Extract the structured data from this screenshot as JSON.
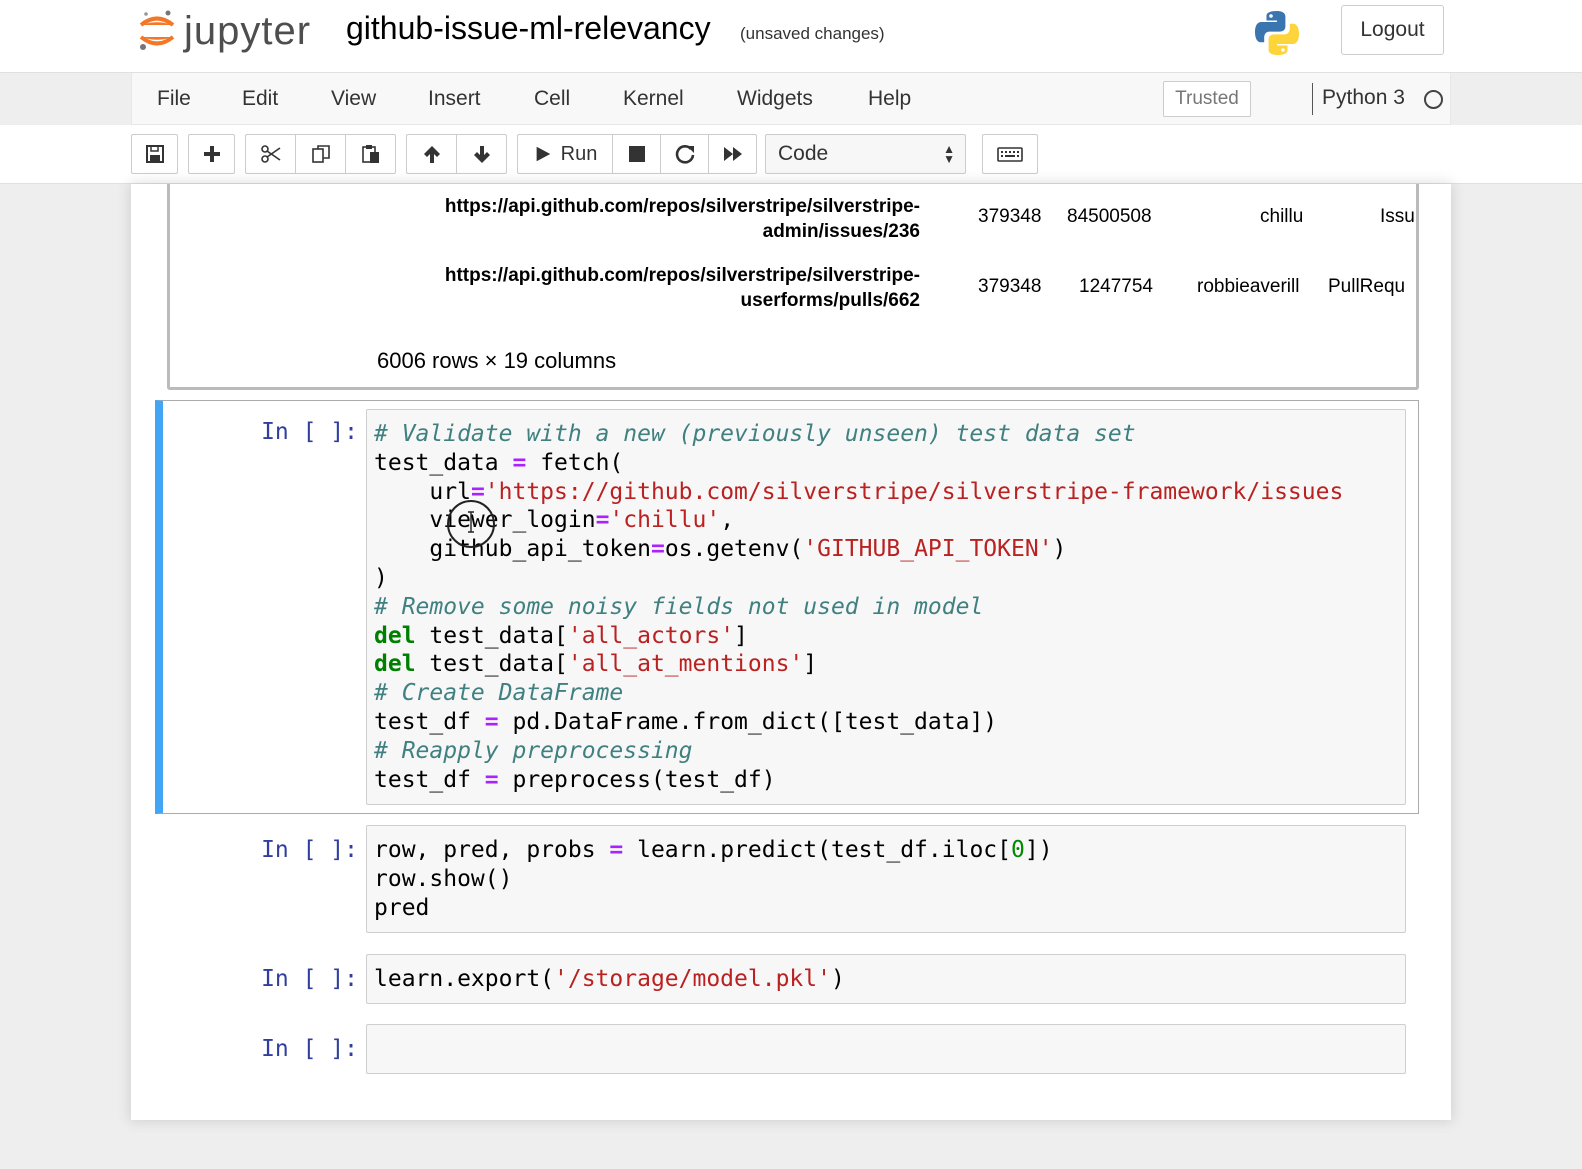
{
  "header": {
    "logo_text": "jupyter",
    "notebook_title": "github-issue-ml-relevancy",
    "save_status": "(unsaved changes)",
    "logout_label": "Logout"
  },
  "menubar": {
    "items": [
      "File",
      "Edit",
      "View",
      "Insert",
      "Cell",
      "Kernel",
      "Widgets",
      "Help"
    ],
    "trusted_label": "Trusted",
    "kernel_name": "Python 3"
  },
  "toolbar": {
    "run_label": "Run",
    "cell_type": "Code",
    "buttons": [
      "save-icon",
      "plus-icon",
      "scissors-icon",
      "copy-icon",
      "paste-icon",
      "arrow-up-icon",
      "arrow-down-icon",
      "play-icon",
      "stop-icon",
      "restart-icon",
      "fast-forward-icon",
      "keyboard-icon"
    ]
  },
  "dataframe": {
    "rows": [
      {
        "url_line1": "https://api.github.com/repos/silverstripe/silverstripe-",
        "url_line2": "admin/issues/236",
        "col1": "379348",
        "col2": "84500508",
        "col3": "chillu",
        "col4": "Issu"
      },
      {
        "url_line1": "https://api.github.com/repos/silverstripe/silverstripe-",
        "url_line2": "userforms/pulls/662",
        "col1": "379348",
        "col2": "1247754",
        "col3": "robbieaverill",
        "col4": "PullRequ"
      }
    ],
    "summary": "6006 rows × 19 columns"
  },
  "cells": [
    {
      "prompt": "In [ ]:",
      "lines": [
        [
          {
            "t": "# Validate with a new (previously unseen) test data set",
            "c": "comment"
          }
        ],
        [
          {
            "t": "test_data "
          },
          {
            "t": "=",
            "c": "op"
          },
          {
            "t": " fetch("
          }
        ],
        [
          {
            "t": "    url"
          },
          {
            "t": "=",
            "c": "op"
          },
          {
            "t": "'https://github.com/silverstripe/silverstripe-framework/issues",
            "c": "string"
          }
        ],
        [
          {
            "t": "    viewer_login"
          },
          {
            "t": "=",
            "c": "op"
          },
          {
            "t": "'chillu'",
            "c": "string"
          },
          {
            "t": ","
          }
        ],
        [
          {
            "t": "    github_api_token"
          },
          {
            "t": "=",
            "c": "op"
          },
          {
            "t": "os.getenv("
          },
          {
            "t": "'GITHUB_API_TOKEN'",
            "c": "string"
          },
          {
            "t": ")"
          }
        ],
        [
          {
            "t": ")"
          }
        ],
        [
          {
            "t": "# Remove some noisy fields not used in model",
            "c": "comment"
          }
        ],
        [
          {
            "t": "del",
            "c": "keyword"
          },
          {
            "t": " test_data["
          },
          {
            "t": "'all_actors'",
            "c": "string"
          },
          {
            "t": "]"
          }
        ],
        [
          {
            "t": "del",
            "c": "keyword"
          },
          {
            "t": " test_data["
          },
          {
            "t": "'all_at_mentions'",
            "c": "string"
          },
          {
            "t": "]"
          }
        ],
        [
          {
            "t": "# Create DataFrame",
            "c": "comment"
          }
        ],
        [
          {
            "t": "test_df "
          },
          {
            "t": "=",
            "c": "op"
          },
          {
            "t": " pd.DataFrame.from_dict([test_data])"
          }
        ],
        [
          {
            "t": "# Reapply preprocessing",
            "c": "comment"
          }
        ],
        [
          {
            "t": "test_df "
          },
          {
            "t": "=",
            "c": "op"
          },
          {
            "t": " preprocess(test_df)"
          }
        ]
      ]
    },
    {
      "prompt": "In [ ]:",
      "lines": [
        [
          {
            "t": "row, pred, probs "
          },
          {
            "t": "=",
            "c": "op"
          },
          {
            "t": " learn.predict(test_df.iloc["
          },
          {
            "t": "0",
            "c": "number"
          },
          {
            "t": "])"
          }
        ],
        [
          {
            "t": "row.show()"
          }
        ],
        [
          {
            "t": "pred"
          }
        ]
      ]
    },
    {
      "prompt": "In [ ]:",
      "lines": [
        [
          {
            "t": "learn.export("
          },
          {
            "t": "'/storage/model.pkl'",
            "c": "string"
          },
          {
            "t": ")"
          }
        ]
      ]
    },
    {
      "prompt": "In [ ]:",
      "lines": [
        [
          {
            "t": ""
          }
        ]
      ]
    }
  ],
  "colors": {
    "selected_cell_border": "#42a5f5",
    "prompt": "#303f9f",
    "comment": "#408080",
    "string": "#ba2121",
    "keyword": "#008000",
    "operator": "#aa22ff"
  }
}
